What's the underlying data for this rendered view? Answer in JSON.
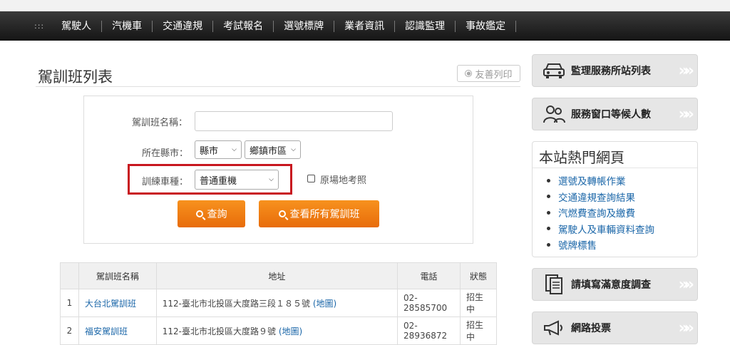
{
  "nav": {
    "dots": ":::",
    "items": [
      "駕駛人",
      "汽機車",
      "交通違規",
      "考試報名",
      "選號標牌",
      "業者資訊",
      "認識監理",
      "事故鑑定"
    ]
  },
  "page": {
    "title": "駕訓班列表",
    "print_label": "友善列印"
  },
  "search": {
    "name_label": "駕訓班名稱：",
    "name_value": "",
    "location_label": "所在縣市：",
    "city_select": "縣市",
    "district_select": "鄉鎮市區",
    "vehicle_label": "訓練車種：",
    "vehicle_select": "普通重機",
    "checkbox_label": "原場地考照",
    "query_button": "查詢",
    "view_all_button": "查看所有駕訓班"
  },
  "table": {
    "headers": [
      "",
      "駕訓班名稱",
      "地址",
      "電話",
      "狀態"
    ],
    "rows": [
      {
        "no": "1",
        "name": "大台北駕訓班",
        "address": "112-臺北市北投區大度路三段１８５號",
        "map": "(地圖)",
        "phone": "02-28585700",
        "status": "招生中"
      },
      {
        "no": "2",
        "name": "福安駕訓班",
        "address": "112-臺北市北投區大度路９號",
        "map": "(地圖)",
        "phone": "02-28936872",
        "status": "招生中"
      }
    ]
  },
  "sidebar": {
    "station_list": "監理服務所站列表",
    "wait_count": "服務窗口等候人數",
    "hot_title": "本站熱門網頁",
    "hot_links": [
      "選號及轉帳作業",
      "交通違規查詢結果",
      "汽燃費查詢及繳費",
      "駕駛人及車輛資料查詢",
      "號牌標售"
    ],
    "survey": "請填寫滿意度調查",
    "vote": "網路投票",
    "arrow": "»»"
  },
  "colors": {
    "accent_orange": "#f7921e",
    "highlight_red": "#c8171f",
    "link_blue": "#1a66a8"
  }
}
